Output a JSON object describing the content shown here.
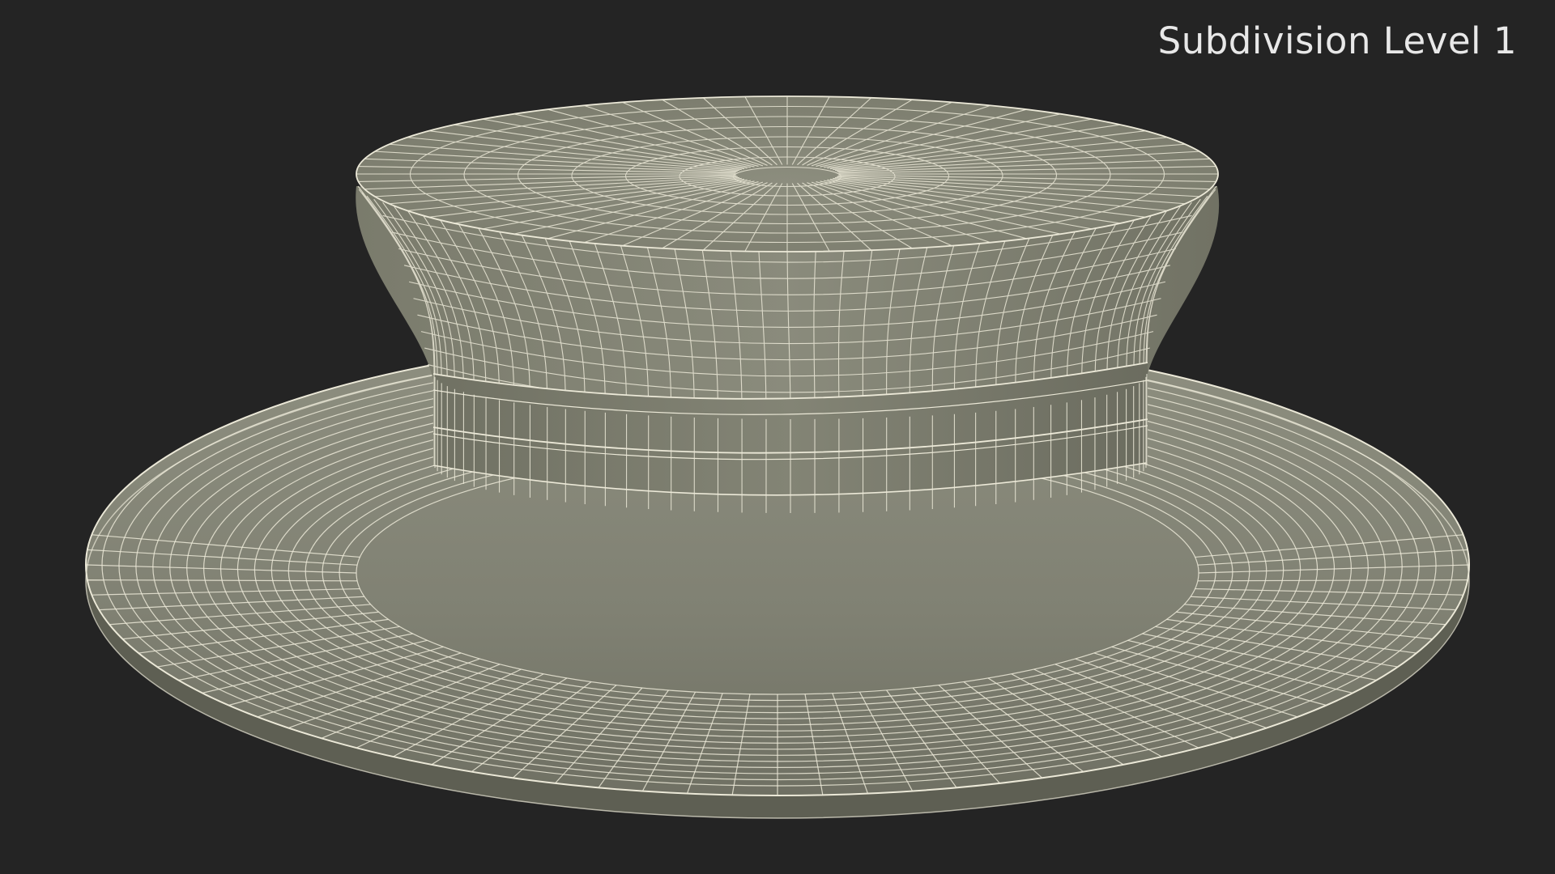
{
  "viewport": {
    "label": "Subdivision Level 1"
  },
  "colors": {
    "background": "#242424",
    "surface_light": "#8e8f80",
    "surface_mid": "#7b7c6d",
    "surface_dark": "#5e5f53",
    "wire": "#ece9d8",
    "label": "#e8e8e8"
  }
}
